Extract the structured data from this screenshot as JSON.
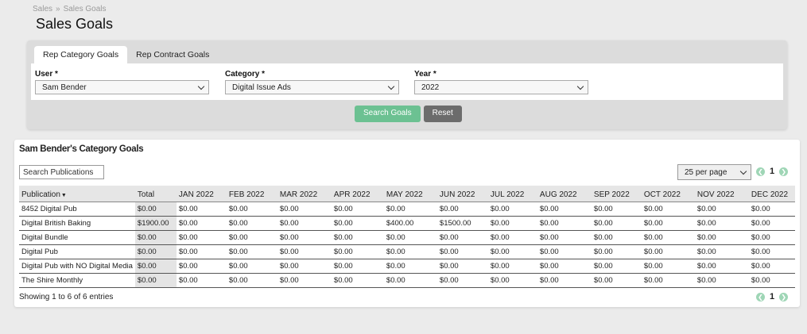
{
  "breadcrumb": {
    "parent": "Sales",
    "separator": "»",
    "current": "Sales Goals"
  },
  "page_title": "Sales Goals",
  "tabs": [
    {
      "label": "Rep Category Goals",
      "active": true
    },
    {
      "label": "Rep Contract Goals",
      "active": false
    }
  ],
  "filters": {
    "user": {
      "label": "User *",
      "value": "Sam Bender"
    },
    "category": {
      "label": "Category *",
      "value": "Digital Issue Ads"
    },
    "year": {
      "label": "Year *",
      "value": "2022"
    }
  },
  "buttons": {
    "search": "Search Goals",
    "reset": "Reset"
  },
  "results": {
    "title": "Sam Bender's Category Goals",
    "search_placeholder": "Search Publications",
    "per_page": "25 per page",
    "page": "1",
    "showing": "Showing 1 to 6 of 6 entries"
  },
  "table": {
    "columns": [
      "Publication",
      "Total",
      "JAN 2022",
      "FEB 2022",
      "MAR 2022",
      "APR 2022",
      "MAY 2022",
      "JUN 2022",
      "JUL 2022",
      "AUG 2022",
      "SEP 2022",
      "OCT 2022",
      "NOV 2022",
      "DEC 2022"
    ],
    "rows": [
      [
        "8452 Digital Pub",
        "$0.00",
        "$0.00",
        "$0.00",
        "$0.00",
        "$0.00",
        "$0.00",
        "$0.00",
        "$0.00",
        "$0.00",
        "$0.00",
        "$0.00",
        "$0.00",
        "$0.00"
      ],
      [
        "Digital British Baking",
        "$1900.00",
        "$0.00",
        "$0.00",
        "$0.00",
        "$0.00",
        "$400.00",
        "$1500.00",
        "$0.00",
        "$0.00",
        "$0.00",
        "$0.00",
        "$0.00",
        "$0.00"
      ],
      [
        "Digital Bundle",
        "$0.00",
        "$0.00",
        "$0.00",
        "$0.00",
        "$0.00",
        "$0.00",
        "$0.00",
        "$0.00",
        "$0.00",
        "$0.00",
        "$0.00",
        "$0.00",
        "$0.00"
      ],
      [
        "Digital Pub",
        "$0.00",
        "$0.00",
        "$0.00",
        "$0.00",
        "$0.00",
        "$0.00",
        "$0.00",
        "$0.00",
        "$0.00",
        "$0.00",
        "$0.00",
        "$0.00",
        "$0.00"
      ],
      [
        "Digital Pub with NO Digital Media",
        "$0.00",
        "$0.00",
        "$0.00",
        "$0.00",
        "$0.00",
        "$0.00",
        "$0.00",
        "$0.00",
        "$0.00",
        "$0.00",
        "$0.00",
        "$0.00",
        "$0.00"
      ],
      [
        "The Shire Monthly",
        "$0.00",
        "$0.00",
        "$0.00",
        "$0.00",
        "$0.00",
        "$0.00",
        "$0.00",
        "$0.00",
        "$0.00",
        "$0.00",
        "$0.00",
        "$0.00",
        "$0.00"
      ]
    ]
  },
  "icons": {
    "prev": "chevron-left-icon",
    "next": "chevron-right-icon"
  },
  "colors": {
    "search_button": "#6cc192",
    "reset_button": "#6c6c6c",
    "pager_arrow": "#9fd6b6"
  }
}
